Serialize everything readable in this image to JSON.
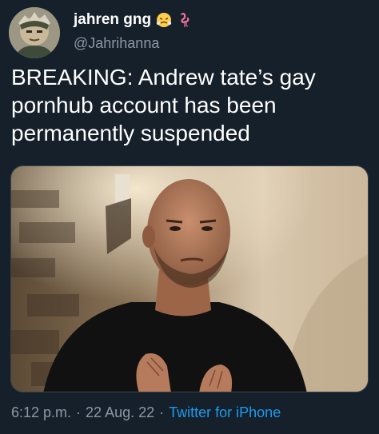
{
  "user": {
    "display_name": "jahren gng",
    "handle": "@Jahrihanna",
    "emojis": [
      "steam-face-emoji",
      "flamingo-emoji"
    ]
  },
  "tweet": {
    "text": "BREAKING: Andrew tate’s gay pornhub account has been permanently suspended",
    "media": {
      "description_icon": "photo-of-man-in-black-shirt"
    }
  },
  "meta": {
    "time": "6:12 p.m.",
    "separator": "·",
    "date": "22 Aug. 22",
    "source": "Twitter for iPhone"
  },
  "colors": {
    "background": "#15202b",
    "text": "#ffffff",
    "secondary_text": "#8b98a5",
    "link": "#1d9bf0"
  }
}
